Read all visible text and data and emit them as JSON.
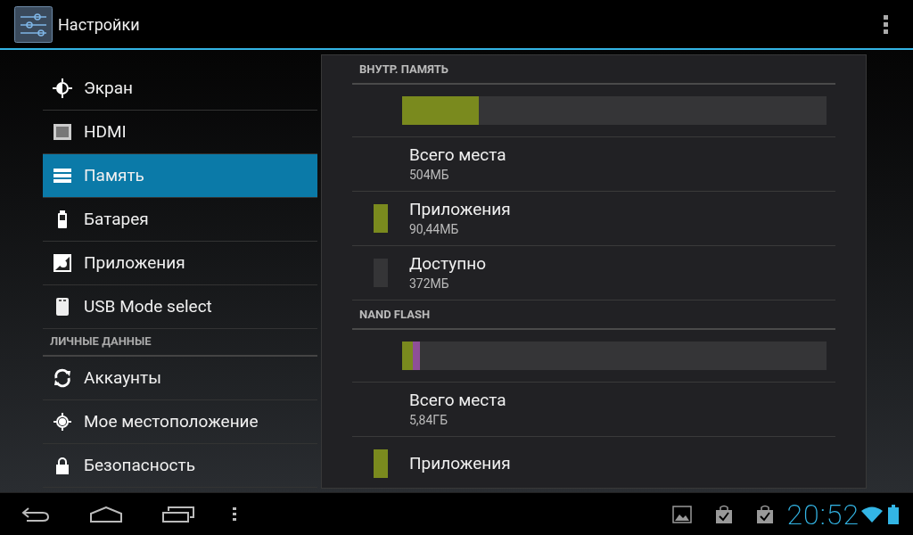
{
  "action_bar": {
    "title": "Настройки"
  },
  "sidebar": {
    "items": [
      {
        "kind": "item",
        "label": "Экран",
        "selected": false
      },
      {
        "kind": "item",
        "label": "HDMI",
        "selected": false
      },
      {
        "kind": "item",
        "label": "Память",
        "selected": true
      },
      {
        "kind": "item",
        "label": "Батарея",
        "selected": false
      },
      {
        "kind": "item",
        "label": "Приложения",
        "selected": false
      },
      {
        "kind": "item",
        "label": "USB Mode select",
        "selected": false
      },
      {
        "kind": "header",
        "label": "ЛИЧНЫЕ ДАННЫЕ"
      },
      {
        "kind": "item",
        "label": "Аккаунты",
        "selected": false
      },
      {
        "kind": "item",
        "label": "Мое местоположение",
        "selected": false
      },
      {
        "kind": "item",
        "label": "Безопасность",
        "selected": false
      }
    ]
  },
  "storage": [
    {
      "title": "ВНУТР. ПАМЯТЬ",
      "segments": [
        {
          "level": 0.18,
          "color": "#7a8a1e"
        }
      ],
      "rows": [
        {
          "label": "Всего места",
          "value": "504МБ"
        },
        {
          "label": "Приложения",
          "value": "90,44МБ",
          "color": "#7a8a1e"
        },
        {
          "label": "Доступно",
          "value": "372МБ",
          "color": "#353537"
        }
      ]
    },
    {
      "title": "NAND FLASH",
      "segments": [
        {
          "level": 0.026,
          "color": "#7a8a1e"
        },
        {
          "level": 0.015,
          "color": "#8e4f98"
        }
      ],
      "rows": [
        {
          "label": "Всего места",
          "value": "5,84ГБ"
        },
        {
          "label": "Приложения",
          "color": "#7a8a1e"
        }
      ]
    }
  ],
  "status_bar": {
    "time": "20:52"
  }
}
